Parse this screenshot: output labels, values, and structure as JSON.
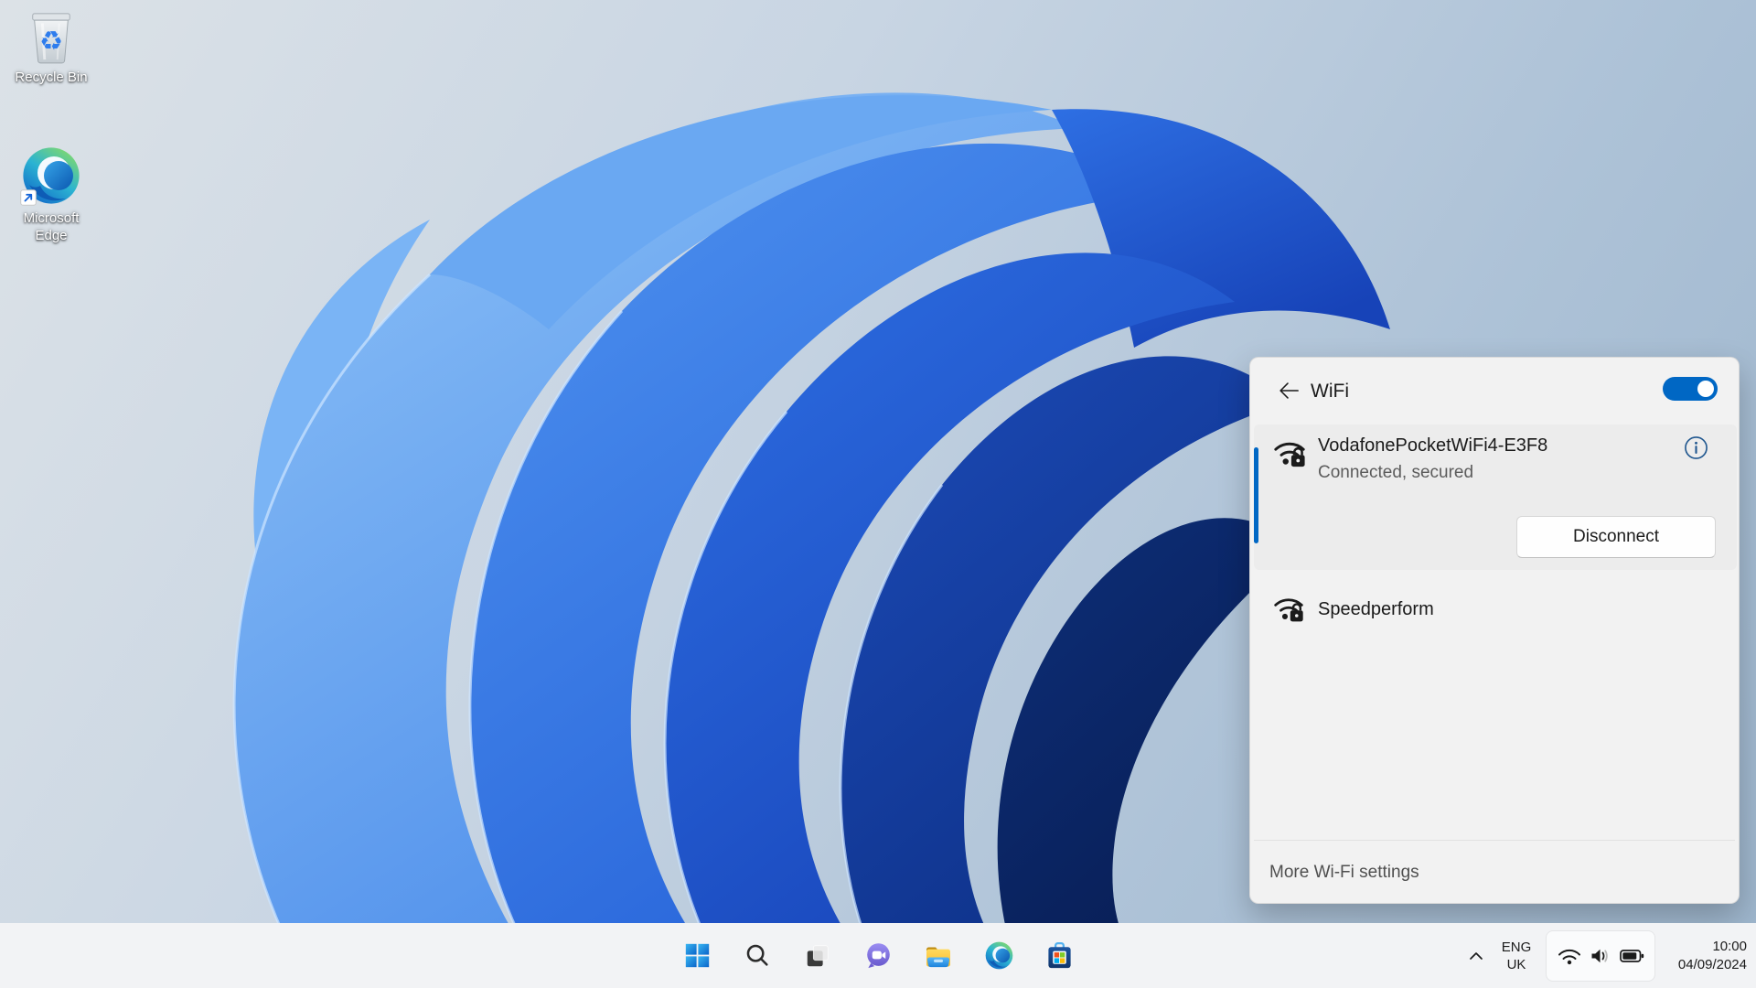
{
  "desktop": {
    "icons": [
      {
        "label": "Recycle Bin",
        "icon": "recycle-bin-icon"
      },
      {
        "label_line1": "Microsoft",
        "label_line2": "Edge",
        "icon": "edge-icon"
      }
    ]
  },
  "wifi_panel": {
    "title": "WiFi",
    "toggle": {
      "state": "on"
    },
    "networks": [
      {
        "name": "VodafonePocketWiFi4-E3F8",
        "status": "Connected, secured",
        "secured": true,
        "connected": true,
        "action_label": "Disconnect",
        "icon": "wifi-secured-icon"
      },
      {
        "name": "Speedperform",
        "secured": true,
        "connected": false,
        "icon": "wifi-secured-icon"
      }
    ],
    "footer_link": "More Wi-Fi settings"
  },
  "taskbar": {
    "buttons": [
      {
        "icon": "start-icon"
      },
      {
        "icon": "search-icon"
      },
      {
        "icon": "task-view-icon"
      },
      {
        "icon": "chat-icon"
      },
      {
        "icon": "file-explorer-icon"
      },
      {
        "icon": "edge-icon"
      },
      {
        "icon": "store-icon"
      }
    ],
    "tray": {
      "chevron_icon": "chevron-up-icon",
      "language_line1": "ENG",
      "language_line2": "UK",
      "status_icons": [
        "wifi-icon",
        "volume-icon",
        "battery-icon"
      ],
      "time": "10:00",
      "date": "04/09/2024"
    }
  },
  "colors": {
    "accent": "#0067C4",
    "panel_bg": "#f2f2f2",
    "taskbar_bg": "#f2f3f5",
    "secondary_text": "#5c5c5c"
  }
}
